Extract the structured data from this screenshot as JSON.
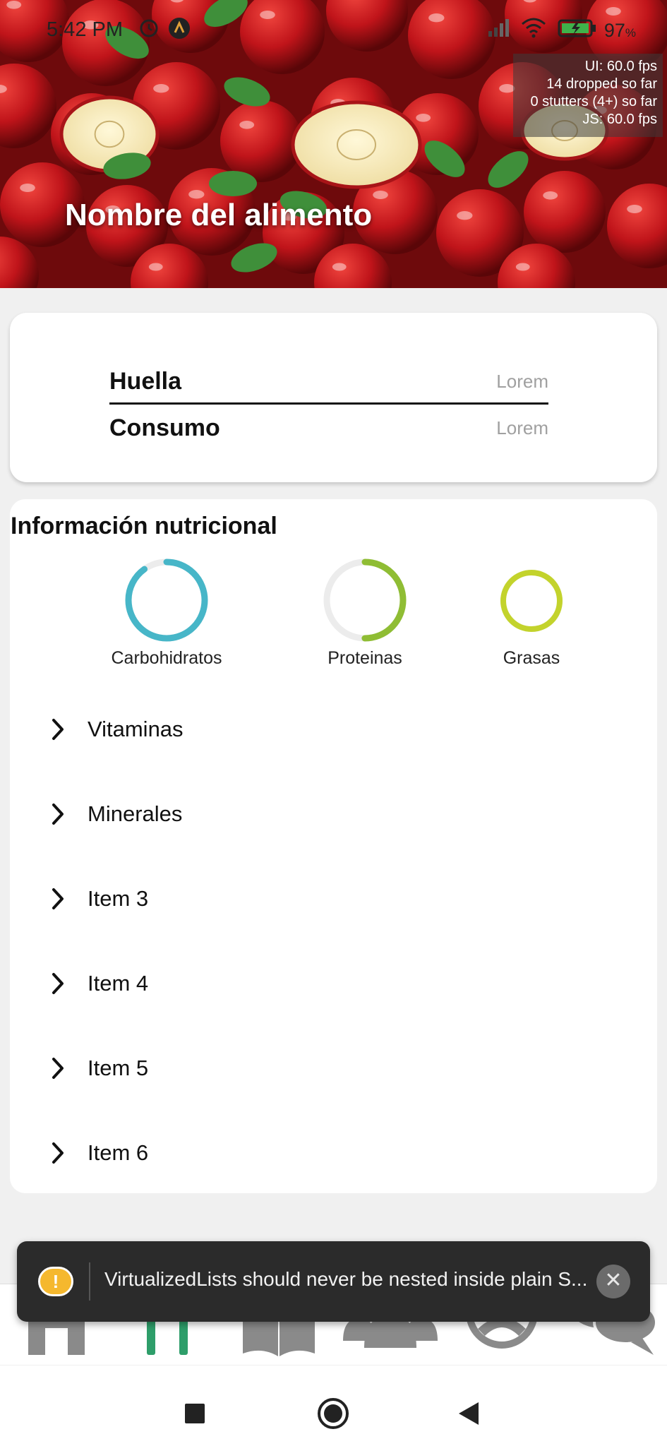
{
  "status_bar": {
    "time": "5:42 PM",
    "battery": "97",
    "icons": [
      "alarm-icon",
      "app-a-icon",
      "signal-icon",
      "wifi-icon",
      "battery-charging-icon"
    ]
  },
  "perf_monitor": {
    "ui_fps": "UI: 60.0 fps",
    "dropped": "14 dropped so far",
    "stutters": "0 stutters (4+) so far",
    "js_fps": "JS: 60.0 fps"
  },
  "hero": {
    "title": "Nombre del alimento"
  },
  "footprint": {
    "rows": [
      {
        "label": "Huella",
        "value": "Lorem"
      },
      {
        "label": "Consumo",
        "value": "Lorem"
      }
    ]
  },
  "nutrition": {
    "title": "Información nutricional",
    "macros": [
      {
        "label": "Carbohidratos",
        "fraction": 0.9,
        "color": "#47b6c8"
      },
      {
        "label": "Proteinas",
        "fraction": 0.5,
        "color": "#8fbd34"
      },
      {
        "label": "Grasas",
        "fraction": 1.0,
        "color": "#c3d32c"
      }
    ],
    "sections": [
      "Vitaminas",
      "Minerales",
      "Item 3",
      "Item 4",
      "Item 5",
      "Item 6"
    ]
  },
  "toast": {
    "message": "VirtualizedLists should never be nested inside plain S...",
    "icon": "warning-icon",
    "close_icon": "close-icon"
  },
  "tabbar": {
    "tabs": [
      "home-icon",
      "food-icon",
      "book-icon",
      "community-icon",
      "profile-icon",
      "chat-icon"
    ],
    "active_color": "#2e9e6a",
    "inactive_color": "#8a8a8a"
  },
  "navbar": {
    "buttons": [
      "recents-icon",
      "home-circle-icon",
      "back-icon"
    ]
  }
}
